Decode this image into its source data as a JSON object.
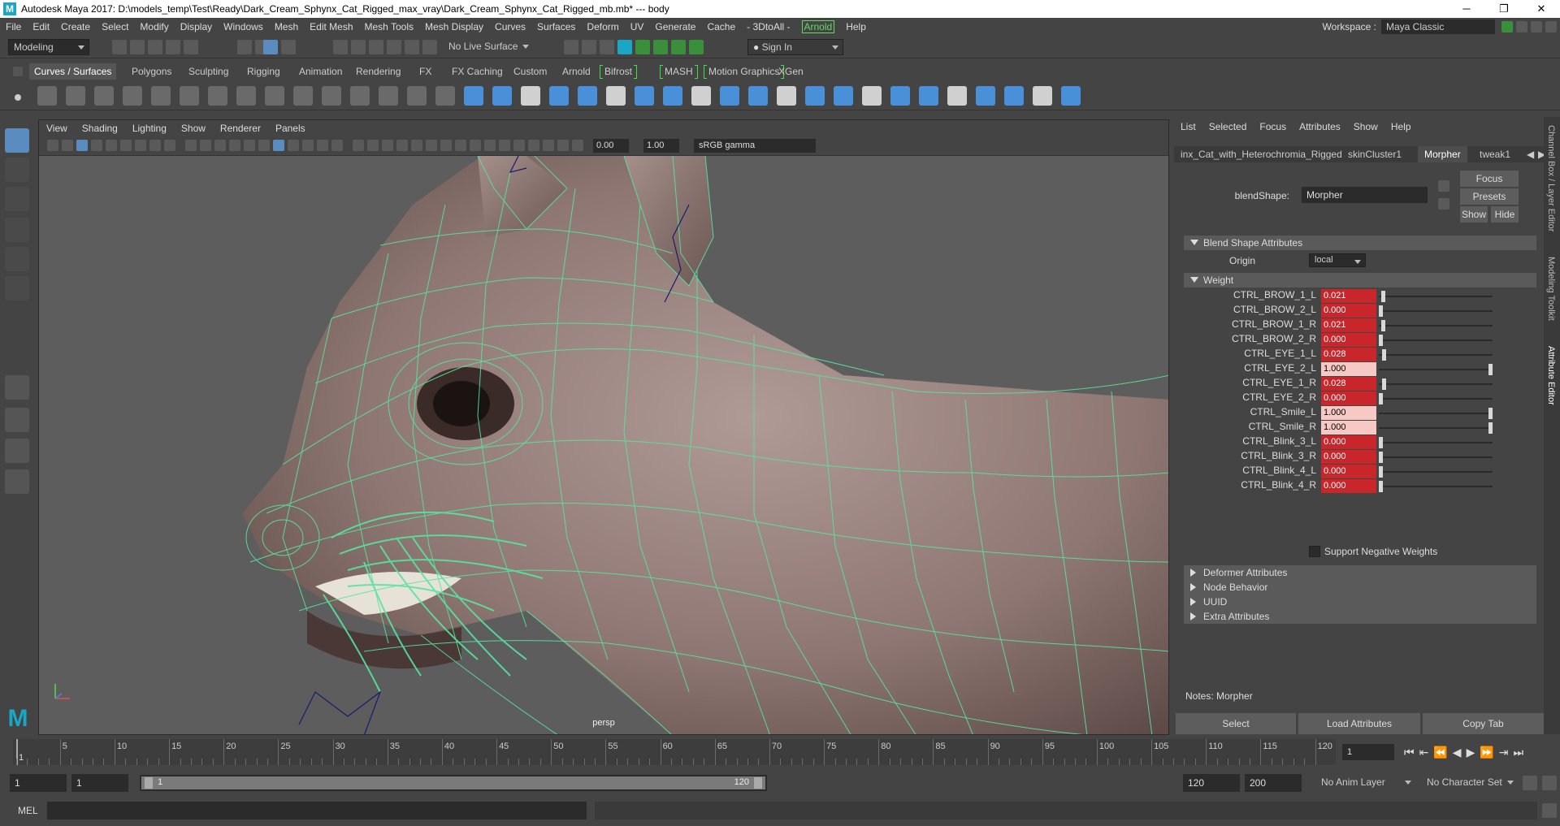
{
  "window": {
    "title": "Autodesk Maya 2017: D:\\models_temp\\Test\\Ready\\Dark_Cream_Sphynx_Cat_Rigged_max_vray\\Dark_Cream_Sphynx_Cat_Rigged_mb.mb*   ---   body",
    "minimize": "─",
    "maximize": "❐",
    "close": "✕"
  },
  "menubar": {
    "items": [
      "File",
      "Edit",
      "Create",
      "Select",
      "Modify",
      "Display",
      "Windows",
      "Mesh",
      "Edit Mesh",
      "Mesh Tools",
      "Mesh Display",
      "Curves",
      "Surfaces",
      "Deform",
      "UV",
      "Generate",
      "Cache",
      "- 3DtoAll -"
    ],
    "arnold": "Arnold",
    "help": "Help",
    "workspace_label": "Workspace :",
    "workspace_value": "Maya Classic"
  },
  "statusline": {
    "menuset": "Modeling",
    "live_surface": "No Live Surface",
    "sign_in": "Sign In"
  },
  "shelf": {
    "tabs": [
      "Curves / Surfaces",
      "Polygons",
      "Sculpting",
      "Rigging",
      "Animation",
      "Rendering",
      "FX",
      "FX Caching",
      "Custom",
      "Arnold",
      "Bifrost",
      "MASH",
      "Motion Graphics",
      "XGen"
    ],
    "active_tab": "Curves / Surfaces"
  },
  "viewport": {
    "menu": [
      "View",
      "Shading",
      "Lighting",
      "Show",
      "Renderer",
      "Panels"
    ],
    "exposure": "0.00",
    "gamma": "1.00",
    "color_management": "sRGB gamma",
    "camera": "persp"
  },
  "attribute_editor": {
    "menu": [
      "List",
      "Selected",
      "Focus",
      "Attributes",
      "Show",
      "Help"
    ],
    "tabs": [
      "inx_Cat_with_Heterochromia_Rigged",
      "skinCluster1",
      "Morpher",
      "tweak1"
    ],
    "active_tab": "Morpher",
    "node_label": "blendShape:",
    "node_value": "Morpher",
    "focus": "Focus",
    "presets": "Presets",
    "show": "Show",
    "hide": "Hide",
    "section_blend": "Blend Shape Attributes",
    "origin_label": "Origin",
    "origin_value": "local",
    "section_weight": "Weight",
    "weights": [
      {
        "name": "CTRL_BROW_1_L",
        "value": "0.021",
        "level": 0.021
      },
      {
        "name": "CTRL_BROW_2_L",
        "value": "0.000",
        "level": 0.0
      },
      {
        "name": "CTRL_BROW_1_R",
        "value": "0.021",
        "level": 0.021
      },
      {
        "name": "CTRL_BROW_2_R",
        "value": "0.000",
        "level": 0.0
      },
      {
        "name": "CTRL_EYE_1_L",
        "value": "0.028",
        "level": 0.028
      },
      {
        "name": "CTRL_EYE_2_L",
        "value": "1.000",
        "level": 1.0
      },
      {
        "name": "CTRL_EYE_1_R",
        "value": "0.028",
        "level": 0.028
      },
      {
        "name": "CTRL_EYE_2_R",
        "value": "0.000",
        "level": 0.0
      },
      {
        "name": "CTRL_Smile_L",
        "value": "1.000",
        "level": 1.0
      },
      {
        "name": "CTRL_Smile_R",
        "value": "1.000",
        "level": 1.0
      },
      {
        "name": "CTRL_Blink_3_L",
        "value": "0.000",
        "level": 0.0
      },
      {
        "name": "CTRL_Blink_3_R",
        "value": "0.000",
        "level": 0.0
      },
      {
        "name": "CTRL_Blink_4_L",
        "value": "0.000",
        "level": 0.0
      },
      {
        "name": "CTRL_Blink_4_R",
        "value": "0.000",
        "level": 0.0
      }
    ],
    "support_negative": "Support Negative Weights",
    "collapsed_sections": [
      "Deformer Attributes",
      "Node Behavior",
      "UUID",
      "Extra Attributes"
    ],
    "notes": "Notes:  Morpher",
    "select_btn": "Select",
    "load_btn": "Load Attributes",
    "copy_btn": "Copy Tab",
    "side_tabs": [
      "Channel Box / Layer Editor",
      "Modeling Toolkit",
      "Attribute Editor"
    ]
  },
  "timeline": {
    "ticks": [
      "5",
      "10",
      "15",
      "20",
      "25",
      "30",
      "35",
      "40",
      "45",
      "50",
      "55",
      "60",
      "65",
      "70",
      "75",
      "80",
      "85",
      "90",
      "95",
      "100",
      "105",
      "110",
      "115",
      "120"
    ],
    "current_marker": "1",
    "current_frame": "1"
  },
  "range": {
    "start": "1",
    "playback_start": "1",
    "slider_start": "1",
    "slider_end": "120",
    "playback_end": "120",
    "end": "200",
    "anim_layer": "No Anim Layer",
    "character_set": "No Character Set"
  },
  "command": {
    "label": "MEL"
  },
  "colors": {
    "wire": "#57e4a0",
    "weight_red": "#c8262b",
    "weight_pink": "#f6c9c5",
    "accent_green": "#5fdc5f"
  }
}
